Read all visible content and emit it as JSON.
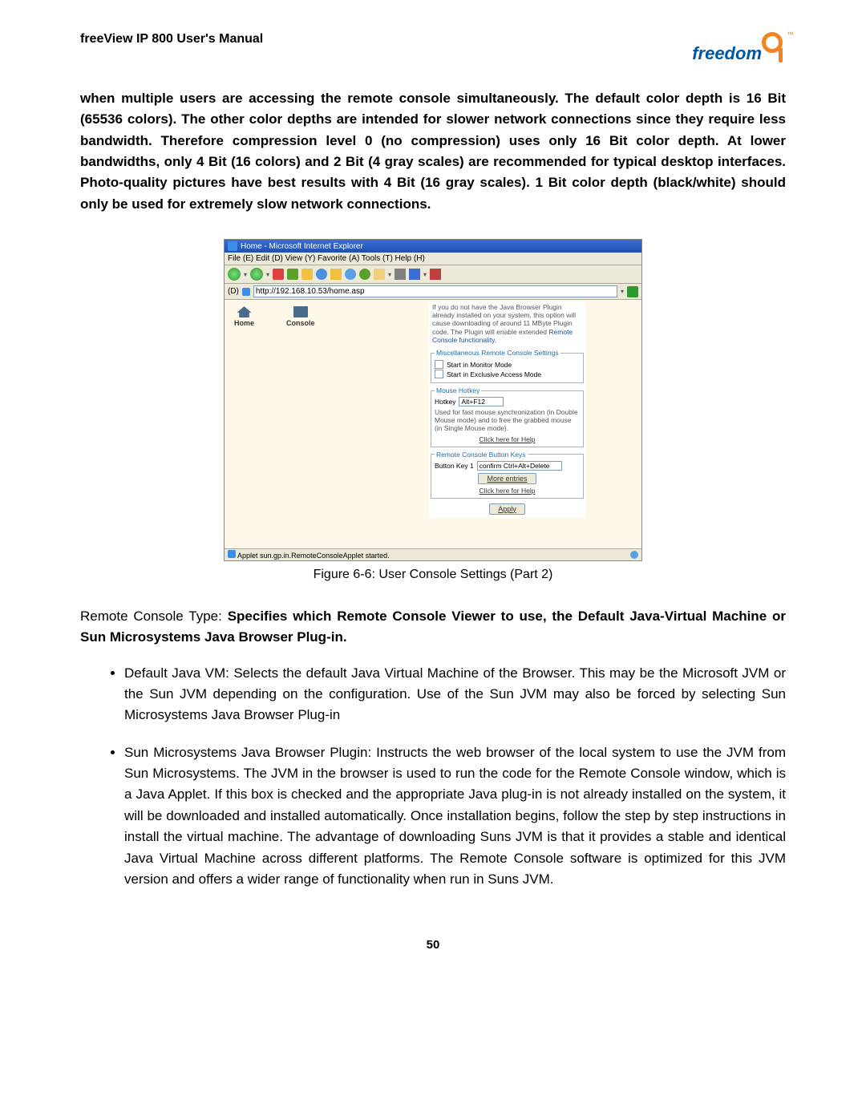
{
  "header": {
    "manual_title": "freeView IP 800 User's Manual",
    "logo_text": "freedom"
  },
  "intro_para": "when multiple users are accessing the remote console simultaneously. The default color depth is 16 Bit (65536 colors). The other color depths are intended for slower network connections since they require less bandwidth. Therefore compression level 0 (no compression) uses only 16 Bit color depth. At lower bandwidths, only 4 Bit (16 colors) and 2 Bit (4 gray scales) are recommended for typical desktop interfaces. Photo-quality pictures have best results with 4 Bit (16 gray scales). 1 Bit color depth (black/white) should only be used for extremely slow network connections.",
  "figure": {
    "caption": "Figure 6-6: User Console Settings (Part 2)",
    "ie": {
      "title": "Home - Microsoft Internet Explorer",
      "menu": "File (E)  Edit (D)  View (Y)  Favorite (A)  Tools (T)  Help (H)",
      "address_label": "(D)",
      "address_url": "http://192.168.10.53/home.asp",
      "status": "Applet sun.gp.in.RemoteConsoleApplet started."
    },
    "nav": {
      "home": "Home",
      "console": "Console"
    },
    "panel": {
      "plugin_note_pre": "If you do not have the Java Browser Plugin already installed on your system, this option will cause downloading of around 11 MByte Plugin code. The Plugin will enable extended ",
      "plugin_note_link": "Remote Console functionality.",
      "misc_legend": "Miscellaneous Remote Console Settings",
      "misc_opt1": "Start in Monitor Mode",
      "misc_opt2": "Start in Exclusive Access Mode",
      "hotkey_legend": "Mouse Hotkey",
      "hotkey_label": "Hotkey",
      "hotkey_value": "Alt+F12",
      "hotkey_note": "Used for fast mouse synchronization (in Double Mouse mode) and to free the grabbed mouse (in Single Mouse mode).",
      "help_link": "Click here for Help",
      "btnkeys_legend": "Remote Console Button Keys",
      "btnkeys_label": "Button Key 1",
      "btnkeys_value": "confirm Ctrl+Alt+Delete",
      "more_btn": "More entries",
      "apply_btn": "Apply"
    }
  },
  "rct_para": {
    "lead": "Remote Console Type: ",
    "bold": "Specifies which Remote Console Viewer to use, the Default Java-Virtual Machine or Sun Microsystems Java Browser Plug-in."
  },
  "bullets": [
    {
      "lead": "Default Java VM: ",
      "bold": "Selects the default Java Virtual Machine of the Browser. This may be the Microsoft JVM or the Sun JVM depending on the configuration. Use of the Sun JVM may also be forced by selecting Sun Microsystems Java Browser Plug-in"
    },
    {
      "lead": "Sun Microsystems Java Browser Plugin: ",
      "bold": "Instructs the web browser of the local system to use the JVM from Sun Microsystems. The JVM in the browser is used to run the code for the Remote Console window, which is a Java Applet. If this box is checked and the appropriate Java plug-in is not already installed on the system, it will be downloaded and installed automatically. Once installation begins, follow the step by step instructions in install the virtual machine. The advantage of downloading Suns JVM is that it provides a stable and identical Java Virtual Machine across different platforms. The Remote Console software is optimized for this JVM version and offers a wider range of functionality when run in Suns JVM."
    }
  ],
  "page_number": "50"
}
